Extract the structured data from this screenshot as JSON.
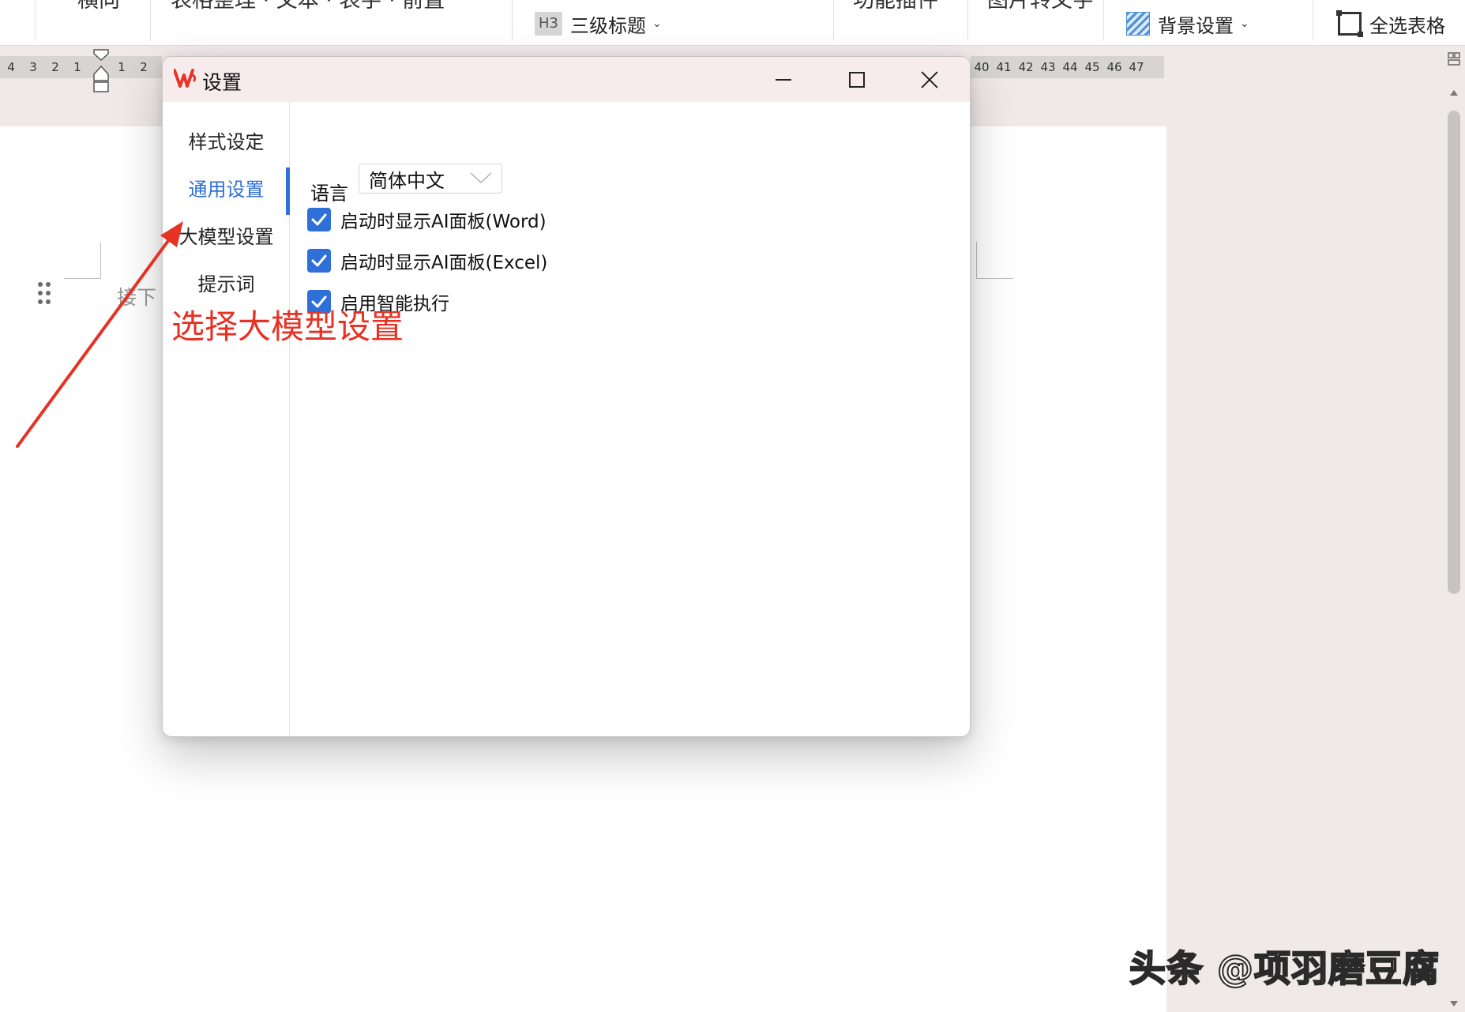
{
  "toolbar": {
    "cut_labels": [
      "横向",
      "表格整理 · 文本 · 表字 · 前置",
      "功能插件",
      "图片转文字"
    ],
    "heading_badge": "H3",
    "heading_label": "三级标题",
    "background_label": "背景设置",
    "select_table_label": "全选表格"
  },
  "ruler": {
    "left_numbers": [
      "4",
      "3",
      "2",
      "1",
      "",
      "1",
      "2"
    ],
    "right_numbers": [
      "40",
      "41",
      "42",
      "43",
      "44",
      "45",
      "46",
      "47"
    ]
  },
  "document": {
    "partial_text": "接下"
  },
  "dialog": {
    "title": "设置",
    "nav": [
      {
        "label": "样式设定",
        "active": false
      },
      {
        "label": "通用设置",
        "active": true
      },
      {
        "label": "大模型设置",
        "active": false
      },
      {
        "label": "提示词",
        "active": false
      }
    ],
    "general": {
      "language_label": "语言",
      "language_value": "简体中文",
      "options": [
        {
          "label": "启动时显示AI面板(Word)",
          "checked": true
        },
        {
          "label": "启动时显示AI面板(Excel)",
          "checked": true
        },
        {
          "label": "启用智能执行",
          "checked": true
        }
      ]
    }
  },
  "annotation": {
    "text": "选择大模型设置",
    "color": "#e53224"
  },
  "watermark": {
    "text": "头条 @项羽磨豆腐"
  },
  "colors": {
    "accent": "#2f6fd8",
    "annotation_red": "#e53224",
    "titlebar": "#f7ecec"
  }
}
